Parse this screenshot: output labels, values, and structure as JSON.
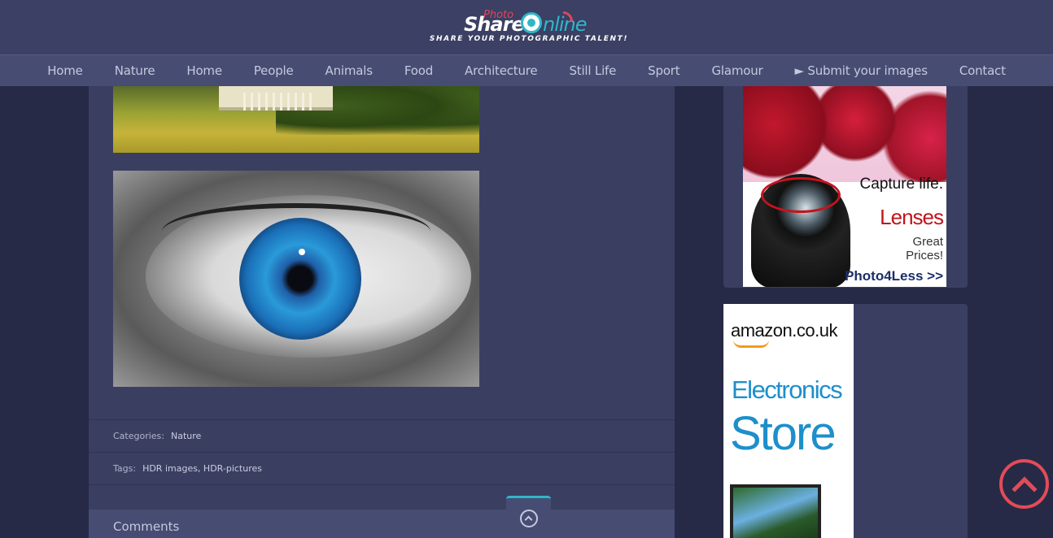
{
  "header": {
    "logo_photo": "Photo",
    "logo_share": "Share",
    "logo_online": "nline",
    "tagline": "SHARE YOUR PHOTOGRAPHIC TALENT!"
  },
  "nav": {
    "items": [
      "Home",
      "Nature",
      "Home",
      "People",
      "Animals",
      "Food",
      "Architecture",
      "Still Life",
      "Sport",
      "Glamour",
      "► Submit your images",
      "Contact"
    ]
  },
  "post": {
    "categories_label": "Categories:",
    "categories_value": "Nature",
    "tags_label": "Tags:",
    "tags_value": "HDR images, HDR-pictures",
    "comments_title": "Comments"
  },
  "ads": {
    "ad1": {
      "line1": "Capture life.",
      "line2": "Lenses",
      "line3": "Great Prices!",
      "brand": "Photo4Less >>"
    },
    "ad2": {
      "brand": "amazon.co.uk",
      "line1": "Electronics",
      "line2": "Store"
    }
  },
  "colors": {
    "accent_red": "#e34b58",
    "accent_teal": "#2fb7c8",
    "header_bg": "#3b4064",
    "nav_bg": "#474c73",
    "content_bg": "#3a3f62",
    "page_bg": "#262a46"
  },
  "icons": {
    "scroll_top": "chevron-up-circle-icon",
    "toggle": "chevron-up-small-circle-icon"
  }
}
